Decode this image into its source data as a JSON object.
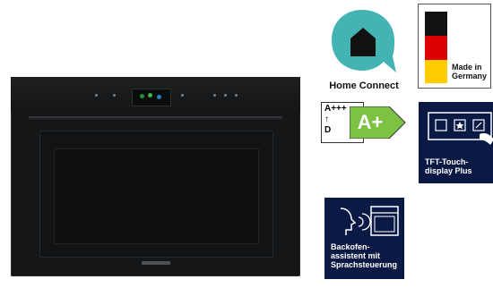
{
  "badges": {
    "home_connect_label": "Home Connect",
    "made_in_label": "Made in\nGermany",
    "energy_range_top": "A+++",
    "energy_range_arrow": "↑",
    "energy_range_bottom": "D",
    "energy_class": "A+",
    "tft_label": "TFT-Touch-\ndisplay Plus",
    "backofen_label": "Backofen-\nassistent mit\nSprachsteuerung"
  },
  "colors": {
    "home_connect": "#44b3b4",
    "energy_green": "#7dc242",
    "tile_navy": "#0b1a44",
    "flag_black": "#111111",
    "flag_red": "#dd0000",
    "flag_gold": "#ffcc00"
  },
  "icons": {
    "home": "home-icon",
    "flag": "germany-flag-icon",
    "touch": "touch-display-icon",
    "voice": "voice-oven-icon"
  }
}
